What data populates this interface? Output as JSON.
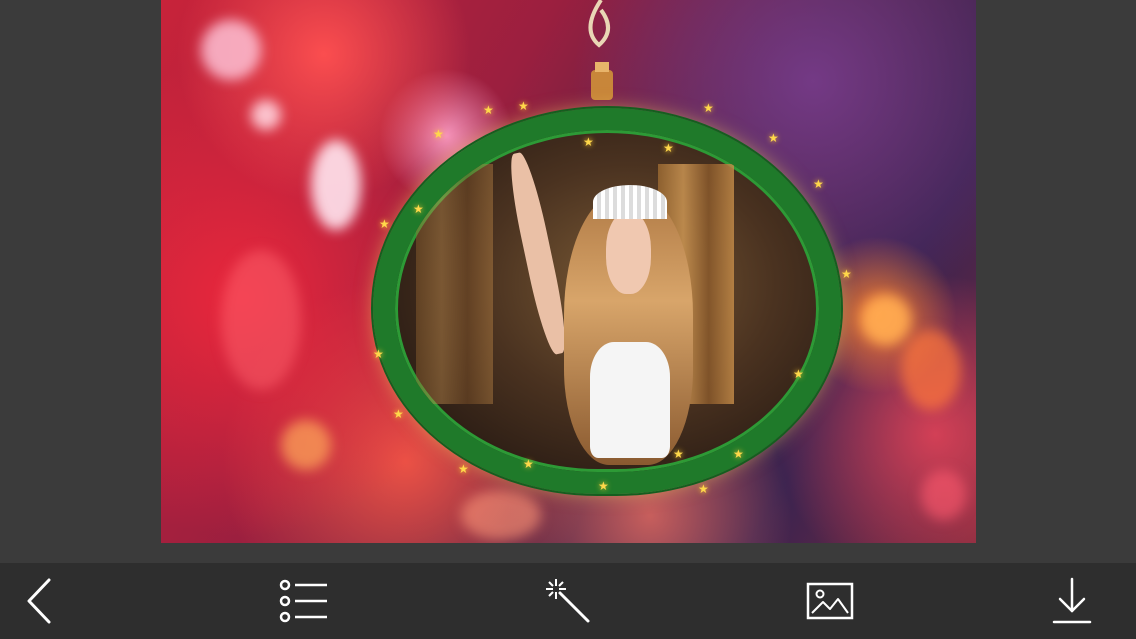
{
  "editor": {
    "canvas": {
      "frame_style": "christmas-wreath-ornament"
    }
  },
  "toolbar": {
    "items": [
      {
        "icon": "back-chevron-icon"
      },
      {
        "icon": "list-icon"
      },
      {
        "icon": "magic-wand-icon"
      },
      {
        "icon": "image-icon"
      },
      {
        "icon": "download-icon"
      }
    ]
  },
  "colors": {
    "toolbar_bg": "#2e2e2e",
    "app_bg": "#3d3d3d",
    "icon": "#ffffff",
    "wreath": "#1f7a2a",
    "star": "#ffd84a"
  }
}
